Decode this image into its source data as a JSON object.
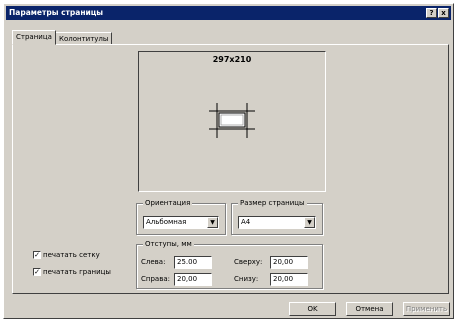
{
  "window": {
    "title": "Параметры страницы",
    "help_label": "?",
    "close_label": "x"
  },
  "tabs": [
    {
      "label": "Страница"
    },
    {
      "label": "Колонтитулы"
    }
  ],
  "preview": {
    "page_size_text": "297x210"
  },
  "orientation": {
    "group_label": "Ориентация",
    "selected": "Альбомная"
  },
  "page_size": {
    "group_label": "Размер страницы",
    "selected": "A4"
  },
  "margins": {
    "group_label": "Отступы, мм",
    "left_label": "Слева:",
    "left_value": "25.00",
    "right_label": "Справа:",
    "right_value": "20,00",
    "top_label": "Сверху:",
    "top_value": "20,00",
    "bottom_label": "Снизу:",
    "bottom_value": "20,00"
  },
  "options": {
    "print_grid_label": "печатать сетку",
    "print_grid_checked": true,
    "print_borders_label": "печатать границы",
    "print_borders_checked": true
  },
  "buttons": {
    "ok_label": "OK",
    "cancel_label": "Отмена",
    "apply_label": "Применить"
  },
  "colors": {
    "titlebar": "#0a246a",
    "face": "#d4d0c8"
  }
}
